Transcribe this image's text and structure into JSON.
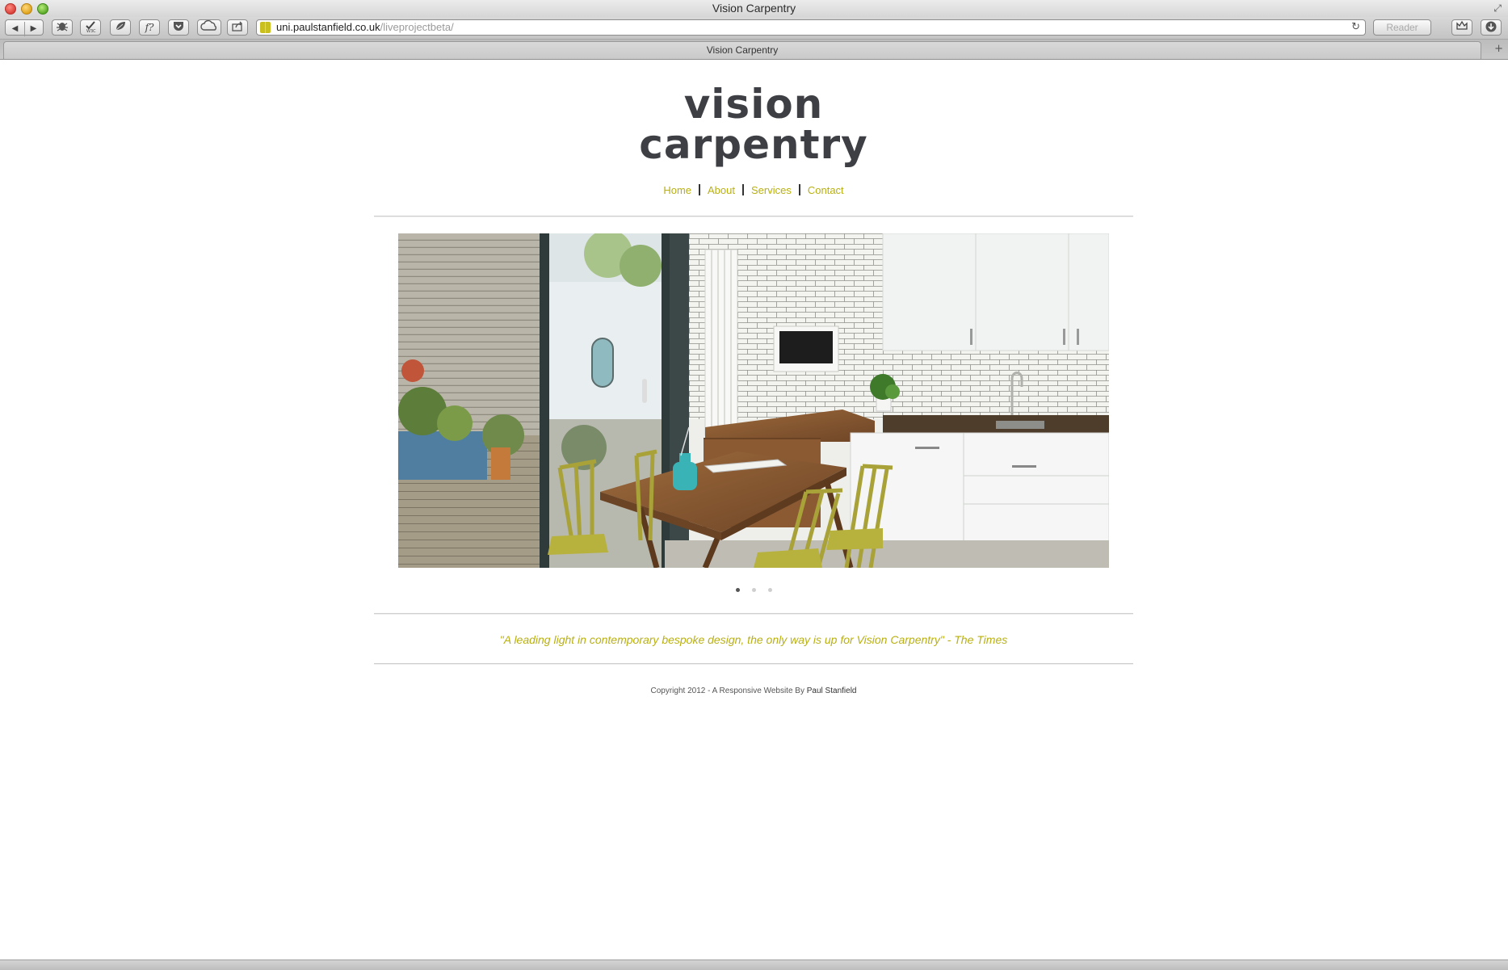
{
  "window": {
    "title": "Vision Carpentry"
  },
  "toolbar": {
    "back_icon": "back-arrow-icon",
    "forward_icon": "forward-arrow-icon",
    "extensions": [
      "bug-icon",
      "w3c-validator-icon",
      "leaf-icon",
      "function-icon",
      "pocket-icon",
      "cloud-icon",
      "share-icon"
    ],
    "url_domain": "uni.paulstanfield.co.uk",
    "url_path": "/liveprojectbeta/",
    "reader_label": "Reader"
  },
  "tab": {
    "title": "Vision Carpentry"
  },
  "site": {
    "logo_line1": "vision",
    "logo_line2": "carpentry",
    "nav": {
      "home": "Home",
      "about": "About",
      "services": "Services",
      "contact": "Contact"
    },
    "slider": {
      "slide_count": 3,
      "active_slide": 1
    },
    "quote": "\"A leading light in contemporary bespoke design, the only way is up for Vision Carpentry\" - The Times",
    "footer": {
      "copyright": "Copyright 2012 - A Responsive Website By",
      "author": "Paul Stanfield"
    }
  },
  "colors": {
    "accent": "#b8b012",
    "logo_text": "#3d3f44"
  }
}
